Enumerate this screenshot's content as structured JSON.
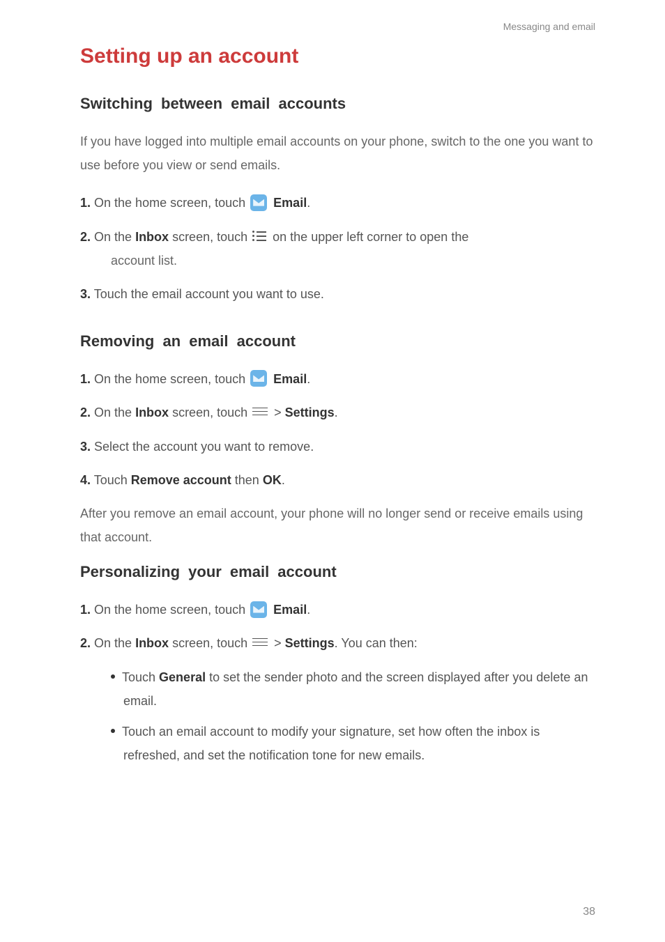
{
  "header": {
    "section": "Messaging and email"
  },
  "title": "Setting up an account",
  "switching": {
    "heading": "Switching between email accounts",
    "intro": "If you have logged into multiple email accounts on your phone, switch to the one you want to use before you view or send emails.",
    "step1_num": "1.",
    "step1_a": " On the home screen, touch ",
    "step1_email": "Email",
    "step1_dot": ".",
    "step2_num": "2.",
    "step2_a": " On the ",
    "step2_inbox": "Inbox",
    "step2_b": " screen, touch ",
    "step2_c": " on the upper left corner to open the",
    "step2_d": "account list.",
    "step3_num": "3.",
    "step3_a": " Touch the email account you want to use."
  },
  "removing": {
    "heading": "Removing an email account",
    "step1_num": "1.",
    "step1_a": " On the home screen, touch ",
    "step1_email": "Email",
    "step1_dot": ".",
    "step2_num": "2.",
    "step2_a": " On the ",
    "step2_inbox": "Inbox",
    "step2_b": " screen, touch ",
    "step2_gt": " > ",
    "step2_settings": "Settings",
    "step2_dot": ".",
    "step3_num": "3.",
    "step3_a": " Select the account you want to remove.",
    "step4_num": "4.",
    "step4_a": " Touch ",
    "step4_remove": "Remove account",
    "step4_b": " then ",
    "step4_ok": "OK",
    "step4_dot": ".",
    "after": "After you remove an email account, your phone will no longer send or receive emails using that account."
  },
  "personalizing": {
    "heading": "Personalizing your email account",
    "step1_num": "1.",
    "step1_a": " On the home screen, touch ",
    "step1_email": "Email",
    "step1_dot": ".",
    "step2_num": "2.",
    "step2_a": " On the ",
    "step2_inbox": "Inbox",
    "step2_b": " screen, touch ",
    "step2_gt": " > ",
    "step2_settings": "Settings",
    "step2_c": ". You can then:",
    "bullet1_a": "Touch ",
    "bullet1_general": "General",
    "bullet1_b": " to set the sender photo and the screen displayed after you delete an email.",
    "bullet2": "Touch an email account to modify your signature, set how often the inbox is refreshed, and set the notification tone for new emails."
  },
  "page": "38"
}
